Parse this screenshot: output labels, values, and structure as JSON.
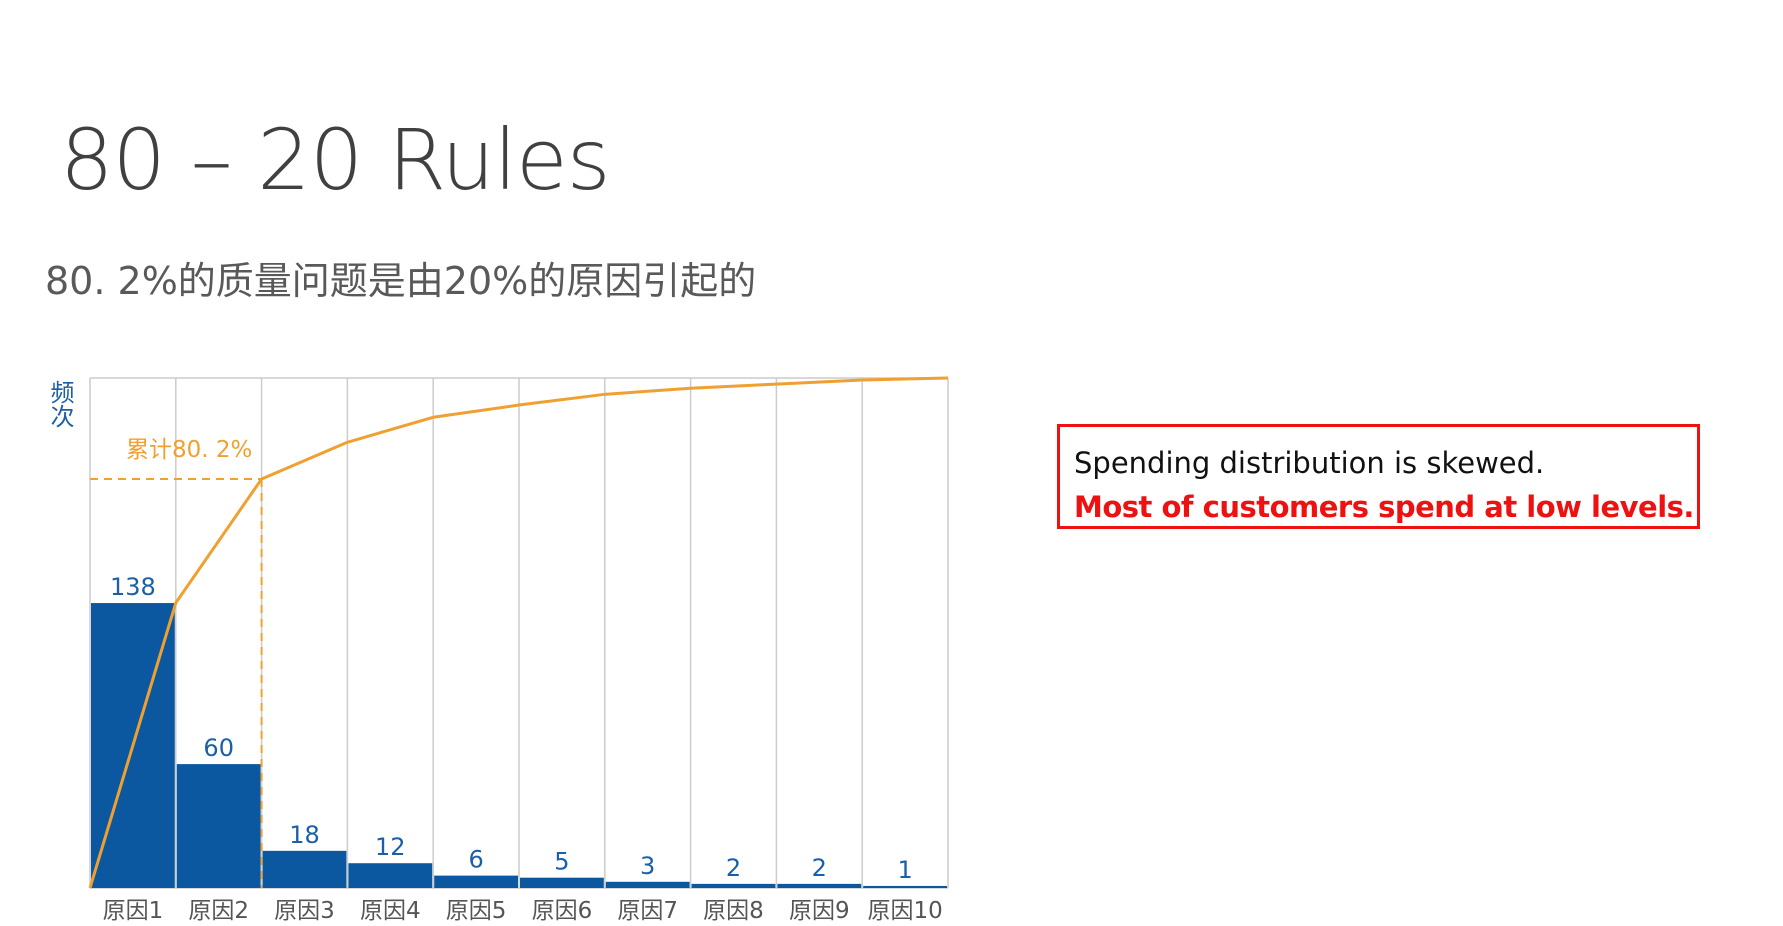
{
  "slide": {
    "title": "80 – 20 Rules",
    "subtitle": "80. 2%的质量问题是由20%的原因引起的"
  },
  "note": {
    "line1": "Spending distribution is skewed.",
    "line2": "Most of customers spend at low levels."
  },
  "colors": {
    "bar": "#0b58a0",
    "cumulative_line": "#f0a030",
    "grid": "#cccccc",
    "axis_label": "#1a5fa8",
    "note_border": "#ee1111"
  },
  "chart_data": {
    "type": "bar",
    "ylabel": "频次",
    "categories": [
      "原因1",
      "原因2",
      "原因3",
      "原因4",
      "原因5",
      "原因6",
      "原因7",
      "原因8",
      "原因9",
      "原因10"
    ],
    "values": [
      138,
      60,
      18,
      12,
      6,
      5,
      3,
      2,
      2,
      1
    ],
    "ylim": [
      0,
      247
    ],
    "cumulative_line": {
      "values_pct": [
        55.9,
        80.2,
        87.4,
        92.3,
        94.7,
        96.8,
        98.0,
        98.8,
        99.6,
        100
      ]
    },
    "annotation": {
      "label": "累计80. 2%",
      "at_category_index": 1,
      "pct": 80.2
    },
    "grid": true
  }
}
